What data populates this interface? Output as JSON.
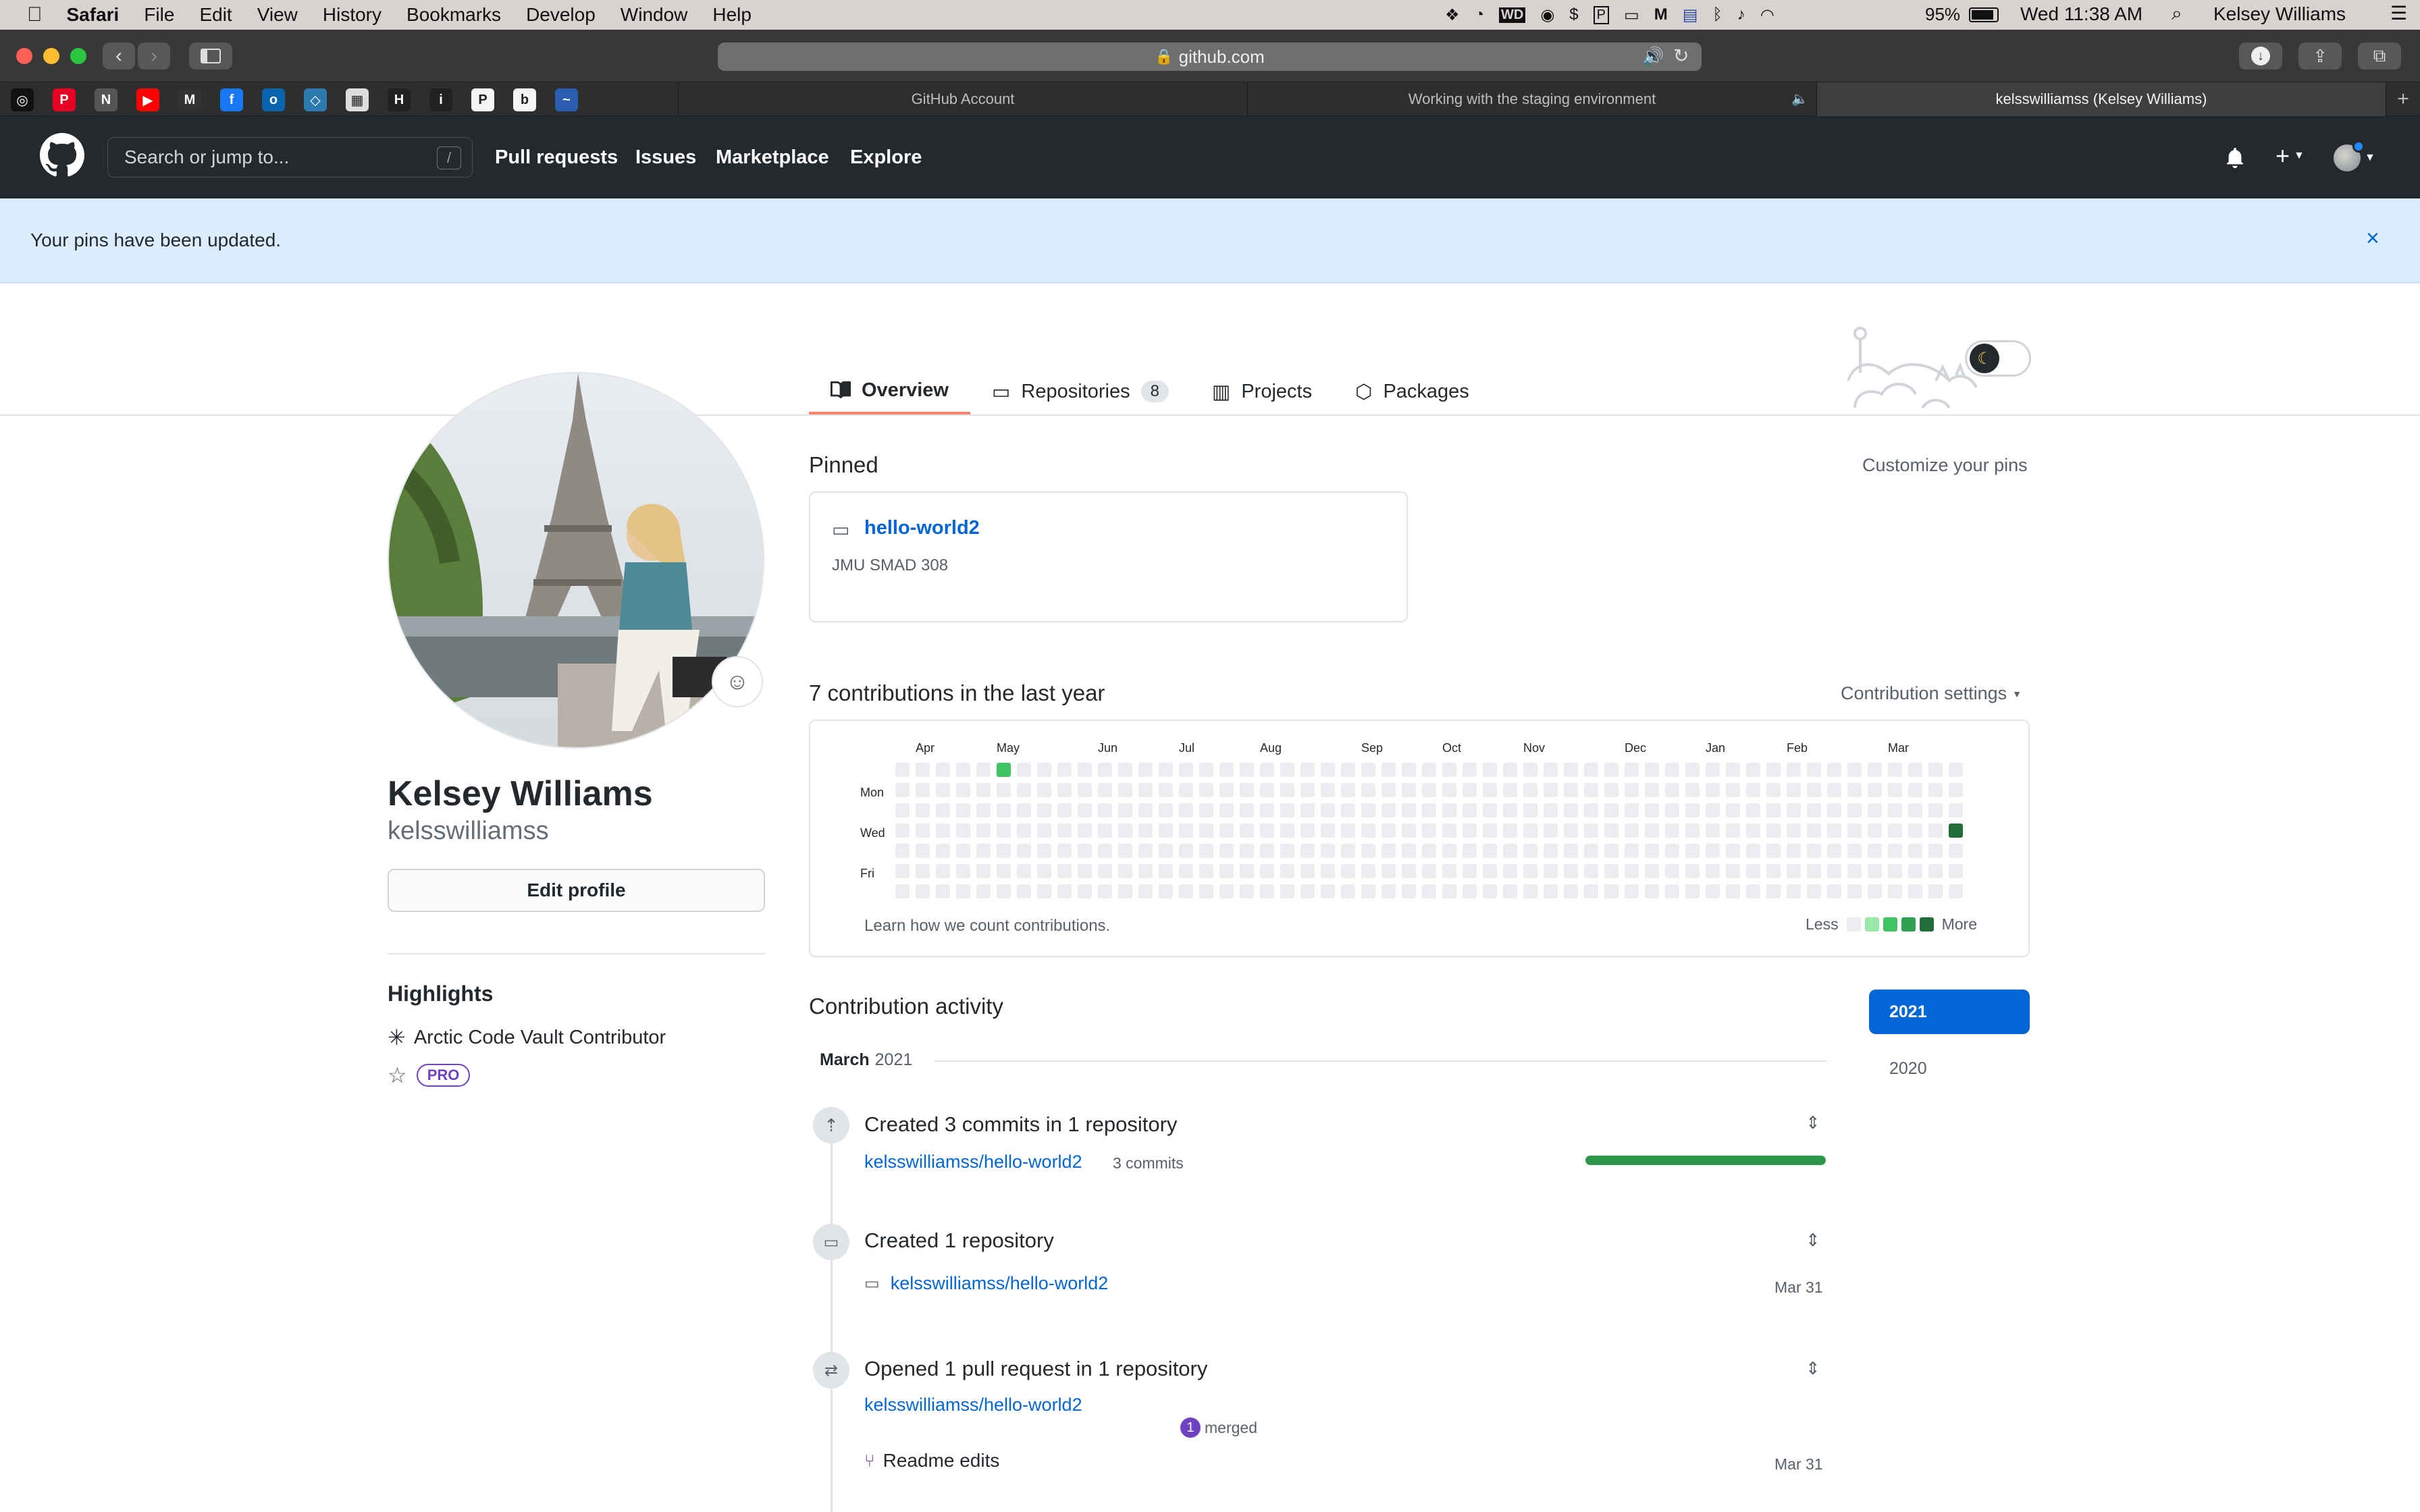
{
  "menubar": {
    "app": "Safari",
    "items": [
      "File",
      "Edit",
      "View",
      "History",
      "Bookmarks",
      "Develop",
      "Window",
      "Help"
    ],
    "battery": "95%",
    "clock": "Wed 11:38 AM",
    "user": "Kelsey Williams"
  },
  "browser": {
    "url": "github.com",
    "tabs": [
      "GitHub Account",
      "Working with the staging environment",
      "kelsswilliamss (Kelsey Williams)"
    ],
    "favorites": [
      {
        "icon": "instagram-icon",
        "glyph": "◎",
        "color": "#111111"
      },
      {
        "icon": "pinterest-icon",
        "glyph": "P",
        "color": "#e60023"
      },
      {
        "icon": "notion-icon",
        "glyph": "N",
        "color": "#555555"
      },
      {
        "icon": "youtube-icon",
        "glyph": "▶",
        "color": "#ff0000"
      },
      {
        "icon": "gmail-icon",
        "glyph": "M",
        "color": "#333333"
      },
      {
        "icon": "facebook-icon",
        "glyph": "f",
        "color": "#1877f2"
      },
      {
        "icon": "outlook-icon",
        "glyph": "o",
        "color": "#0a64ad"
      },
      {
        "icon": "canvas-icon",
        "glyph": "◇",
        "color": "#2a7ab0"
      },
      {
        "icon": "doc-icon",
        "glyph": "▦",
        "color": "#dddddd"
      },
      {
        "icon": "hootsuite-icon",
        "glyph": "H",
        "color": "#222222"
      },
      {
        "icon": "info-icon",
        "glyph": "i",
        "color": "#222222"
      },
      {
        "icon": "p-app-icon",
        "glyph": "P",
        "color": "#f5f5f5"
      },
      {
        "icon": "behance-icon",
        "glyph": "b",
        "color": "#f5f5f5"
      },
      {
        "icon": "wave-icon",
        "glyph": "~",
        "color": "#2a5db0"
      }
    ]
  },
  "github": {
    "search_placeholder": "Search or jump to...",
    "search_key": "/",
    "nav": [
      "Pull requests",
      "Issues",
      "Marketplace",
      "Explore"
    ]
  },
  "flash": {
    "message": "Your pins have been updated."
  },
  "profile": {
    "name": "Kelsey Williams",
    "login": "kelsswilliamss",
    "edit_button": "Edit profile",
    "highlights_title": "Highlights",
    "highlight_item": "Arctic Code Vault Contributor",
    "pro_badge": "PRO"
  },
  "tabs": {
    "overview": "Overview",
    "repositories": "Repositories",
    "repo_count": "8",
    "projects": "Projects",
    "packages": "Packages"
  },
  "pinned": {
    "title": "Pinned",
    "customize": "Customize your pins",
    "repo_name": "hello-world2",
    "repo_desc": "JMU SMAD 308"
  },
  "contributions": {
    "title": "7 contributions in the last year",
    "settings": "Contribution settings",
    "months": [
      "Apr",
      "May",
      "Jun",
      "Jul",
      "Aug",
      "Sep",
      "Oct",
      "Nov",
      "Dec",
      "Jan",
      "Feb",
      "Mar"
    ],
    "days": [
      "Mon",
      "Wed",
      "Fri"
    ],
    "learn": "Learn how we count contributions.",
    "less": "Less",
    "more": "More",
    "legend_colors": [
      "#ebedf0",
      "#9be9a8",
      "#40c463",
      "#30a14e",
      "#216e39"
    ],
    "weeks": 53,
    "active_cells": [
      {
        "week": 5,
        "day": 0,
        "level": 2
      },
      {
        "week": 52,
        "day": 3,
        "level": 4
      }
    ]
  },
  "activity": {
    "title": "Contribution activity",
    "years": [
      "2021",
      "2020"
    ],
    "selected_year": "2021",
    "month": "March",
    "year": "2021",
    "commits": {
      "summary": "Created 3 commits in 1 repository",
      "repo": "kelsswilliamss/hello-world2",
      "count": "3 commits",
      "share": 1.0
    },
    "created": {
      "summary": "Created 1 repository",
      "repo": "kelsswilliamss/hello-world2",
      "date": "Mar 31"
    },
    "pr": {
      "summary": "Opened 1 pull request in 1 repository",
      "repo": "kelsswilliamss/hello-world2",
      "merged_count": "1",
      "merged_label": "merged",
      "title": "Readme edits",
      "date": "Mar 31"
    }
  }
}
